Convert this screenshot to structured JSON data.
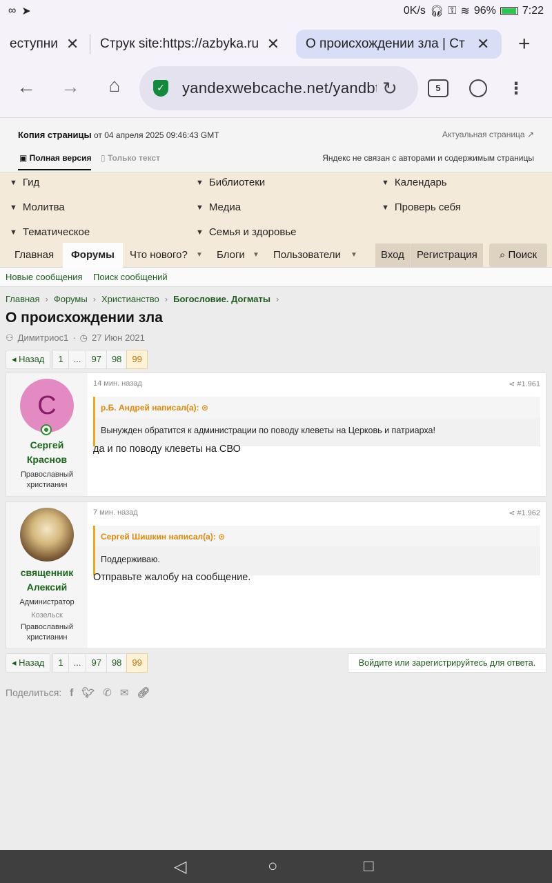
{
  "status": {
    "network_speed": "0K/s",
    "battery_percent": "96%",
    "time": "7:22",
    "left_icons": [
      "infinity-icon",
      "telegram-icon"
    ],
    "right_icons": [
      "headphones-icon",
      "vpn-key-icon",
      "wifi-icon",
      "battery-icon"
    ]
  },
  "browser": {
    "tabs": [
      {
        "label": "еступни"
      },
      {
        "label": "Струк site:https://azbyka.ru"
      },
      {
        "label": "О происхождении зла | Ст"
      }
    ],
    "new_tab": "+",
    "url": "yandexwebcache.net/yandbtm?",
    "tab_count": "5"
  },
  "cache": {
    "title": "Копия страницы",
    "date": "от 04 апреля 2025 09:46:43 GMT",
    "actual_link": "Актуальная страница",
    "mode_full": "Полная версия",
    "mode_text": "Только текст",
    "disclaimer": "Яндекс не связан с авторами и содержимым страницы"
  },
  "categories": [
    {
      "label": "Гид"
    },
    {
      "label": "Библиотеки"
    },
    {
      "label": "Календарь"
    },
    {
      "label": "Молитва"
    },
    {
      "label": "Медиа"
    },
    {
      "label": "Проверь себя"
    },
    {
      "label": "Тематическое"
    },
    {
      "label": "Семья и здоровье"
    }
  ],
  "nav": {
    "items": [
      {
        "label": "Главная"
      },
      {
        "label": "Форумы"
      },
      {
        "label": "Что нового?"
      },
      {
        "label": "Блоги"
      },
      {
        "label": "Пользователи"
      }
    ],
    "login": "Вход",
    "register": "Регистрация",
    "search": "Поиск"
  },
  "subnav": {
    "new_posts": "Новые сообщения",
    "search_posts": "Поиск сообщений"
  },
  "breadcrumb": [
    "Главная",
    "Форумы",
    "Христианство",
    "Богословие. Догматы"
  ],
  "thread": {
    "title": "О происхождении зла",
    "author": "Димитриос1",
    "date": "27 Июн 2021"
  },
  "pager": {
    "back": "Назад",
    "pages": [
      "1",
      "...",
      "97",
      "98",
      "99"
    ],
    "current": "99"
  },
  "posts": [
    {
      "avatar_letter": "С",
      "user_name_1": "Сергей",
      "user_name_2": "Краснов",
      "role_1": "Православный",
      "role_2": "христианин",
      "time": "14 мин. назад",
      "number": "#1.961",
      "quote_author": "р.Б. Андрей написал(а):",
      "quote_text": "Вынужден обратится к администрации по поводу клеветы на Церковь и патриарха!",
      "text": "да и по поводу клеветы на СВО"
    },
    {
      "user_name_1": "священник",
      "user_name_2": "Алексий",
      "title": "Администратор",
      "location": "Козельск",
      "role_1": "Православный",
      "role_2": "христианин",
      "time": "7 мин. назад",
      "number": "#1.962",
      "quote_author": "Сергей Шишкин написал(а):",
      "quote_text": "Поддерживаю.",
      "text": "Отправьте жалобу на сообщение."
    }
  ],
  "reply_hint": "Войдите или зарегистрируйтесь для ответа.",
  "share": {
    "label": "Поделиться:",
    "icons": [
      "facebook-icon",
      "twitter-icon",
      "whatsapp-icon",
      "email-icon",
      "link-icon"
    ]
  },
  "colors": {
    "link_green": "#1e5c1e",
    "quote_orange": "#e08a0b",
    "nav_bg": "#f3ead9",
    "active_tab": "#d9def7"
  }
}
